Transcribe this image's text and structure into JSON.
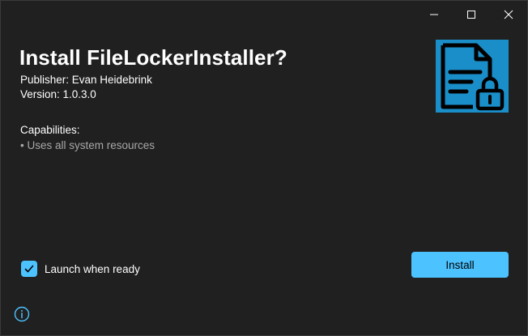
{
  "window": {
    "minimize_icon": "minimize-icon",
    "maximize_icon": "maximize-icon",
    "close_icon": "close-icon"
  },
  "installer": {
    "title": "Install FileLockerInstaller?",
    "publisher": "Publisher: Evan Heidebrink",
    "version": "Version: 1.0.3.0",
    "capabilities_heading": "Capabilities:",
    "capabilities": [
      "• Uses all system resources"
    ],
    "app_icon": "document-lock-icon"
  },
  "footer": {
    "launch_label": "Launch when ready",
    "launch_checked": true,
    "install_label": "Install",
    "info_icon": "info-icon"
  },
  "colors": {
    "background": "#202020",
    "accent": "#4cc2ff",
    "logo_background": "#1a8ec9",
    "secondary_text": "#a8a8a8"
  }
}
